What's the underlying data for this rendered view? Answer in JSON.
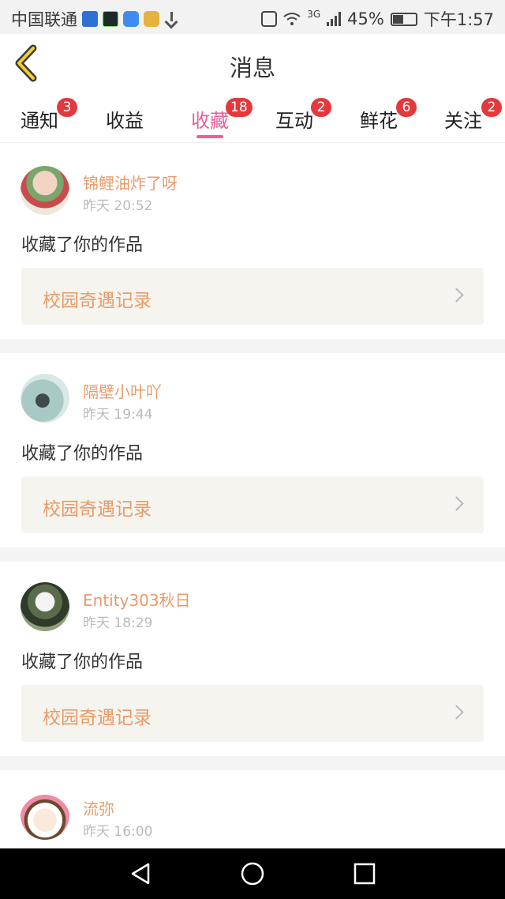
{
  "status_bar": {
    "carrier": "中国联通",
    "network": "3G",
    "battery": "45%",
    "time": "下午1:57"
  },
  "header": {
    "title": "消息",
    "back_icon": "chevron-left-icon",
    "accent_color": "#e8609b"
  },
  "tabs": [
    {
      "label": "通知",
      "badge": "3"
    },
    {
      "label": "收益",
      "badge": ""
    },
    {
      "label": "收藏",
      "badge": "18",
      "active": true
    },
    {
      "label": "互动",
      "badge": "2"
    },
    {
      "label": "鲜花",
      "badge": "6"
    },
    {
      "label": "关注",
      "badge": "2"
    }
  ],
  "feed": [
    {
      "user": "锦鲤油炸了呀",
      "time": "昨天 20:52",
      "action": "收藏了你的作品",
      "work": "校园奇遇记录"
    },
    {
      "user": "隔壁小叶吖",
      "time": "昨天 19:44",
      "action": "收藏了你的作品",
      "work": "校园奇遇记录"
    },
    {
      "user": "Entity303秋日",
      "time": "昨天 18:29",
      "action": "收藏了你的作品",
      "work": "校园奇遇记录"
    },
    {
      "user": "流弥",
      "time": "昨天 16:00"
    }
  ],
  "nav_bar": {
    "back": "triangle-back-icon",
    "home": "circle-home-icon",
    "recents": "square-recents-icon"
  }
}
